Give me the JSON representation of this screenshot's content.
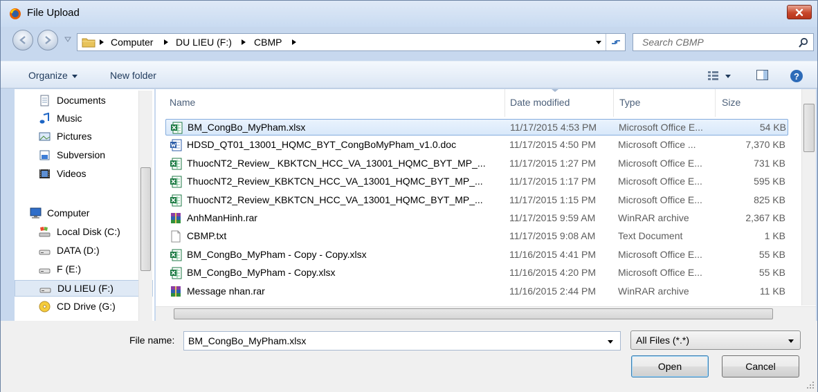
{
  "window": {
    "title": "File Upload"
  },
  "address": {
    "crumbs": [
      "Computer",
      "DU LIEU (F:)",
      "CBMP"
    ],
    "search_placeholder": "Search CBMP"
  },
  "toolbar": {
    "organize_label": "Organize",
    "new_folder_label": "New folder"
  },
  "nav": {
    "items": [
      {
        "label": "Documents",
        "icon": "documents-icon"
      },
      {
        "label": "Music",
        "icon": "music-icon"
      },
      {
        "label": "Pictures",
        "icon": "pictures-icon"
      },
      {
        "label": "Subversion",
        "icon": "subversion-icon"
      },
      {
        "label": "Videos",
        "icon": "videos-icon"
      },
      {
        "label": "Computer",
        "icon": "computer-icon"
      },
      {
        "label": "Local Disk (C:)",
        "icon": "local-disk-icon"
      },
      {
        "label": "DATA (D:)",
        "icon": "drive-icon"
      },
      {
        "label": "F (E:)",
        "icon": "drive-icon"
      },
      {
        "label": "DU LIEU (F:)",
        "icon": "drive-icon",
        "selected": true
      },
      {
        "label": "CD Drive (G:)",
        "icon": "cd-drive-icon"
      }
    ]
  },
  "files": {
    "columns": {
      "name": "Name",
      "date": "Date modified",
      "type": "Type",
      "size": "Size"
    },
    "rows": [
      {
        "name": "BM_CongBo_MyPham.xlsx",
        "date": "11/17/2015 4:53 PM",
        "type": "Microsoft Office E...",
        "size": "54 KB",
        "icon": "excel-icon",
        "selected": true
      },
      {
        "name": "HDSD_QT01_13001_HQMC_BYT_CongBoMyPham_v1.0.doc",
        "date": "11/17/2015 4:50 PM",
        "type": "Microsoft Office ...",
        "size": "7,370 KB",
        "icon": "word-icon"
      },
      {
        "name": "ThuocNT2_Review_ KBKTCN_HCC_VA_13001_HQMC_BYT_MP_...",
        "date": "11/17/2015 1:27 PM",
        "type": "Microsoft Office E...",
        "size": "731 KB",
        "icon": "excel-icon"
      },
      {
        "name": "ThuocNT2_Review_KBKTCN_HCC_VA_13001_HQMC_BYT_MP_...",
        "date": "11/17/2015 1:17 PM",
        "type": "Microsoft Office E...",
        "size": "595 KB",
        "icon": "excel-icon"
      },
      {
        "name": "ThuocNT2_Review_KBKTCN_HCC_VA_13001_HQMC_BYT_MP_...",
        "date": "11/17/2015 1:15 PM",
        "type": "Microsoft Office E...",
        "size": "825 KB",
        "icon": "excel-icon"
      },
      {
        "name": "AnhManHinh.rar",
        "date": "11/17/2015 9:59 AM",
        "type": "WinRAR archive",
        "size": "2,367 KB",
        "icon": "winrar-icon"
      },
      {
        "name": "CBMP.txt",
        "date": "11/17/2015 9:08 AM",
        "type": "Text Document",
        "size": "1 KB",
        "icon": "text-file-icon"
      },
      {
        "name": "BM_CongBo_MyPham - Copy - Copy.xlsx",
        "date": "11/16/2015 4:41 PM",
        "type": "Microsoft Office E...",
        "size": "55 KB",
        "icon": "excel-icon"
      },
      {
        "name": "BM_CongBo_MyPham - Copy.xlsx",
        "date": "11/16/2015 4:20 PM",
        "type": "Microsoft Office E...",
        "size": "55 KB",
        "icon": "excel-icon"
      },
      {
        "name": "Message nhan.rar",
        "date": "11/16/2015 2:44 PM",
        "type": "WinRAR archive",
        "size": "11 KB",
        "icon": "winrar-icon"
      }
    ]
  },
  "footer": {
    "file_name_label": "File name:",
    "file_name_value": "BM_CongBo_MyPham.xlsx",
    "filter_value": "All Files (*.*)",
    "open_label": "Open",
    "cancel_label": "Cancel"
  },
  "colors": {
    "selection": "#d8e8fa",
    "selection_border": "#84acdd",
    "close": "#c8472b",
    "link": "#1e395b"
  }
}
